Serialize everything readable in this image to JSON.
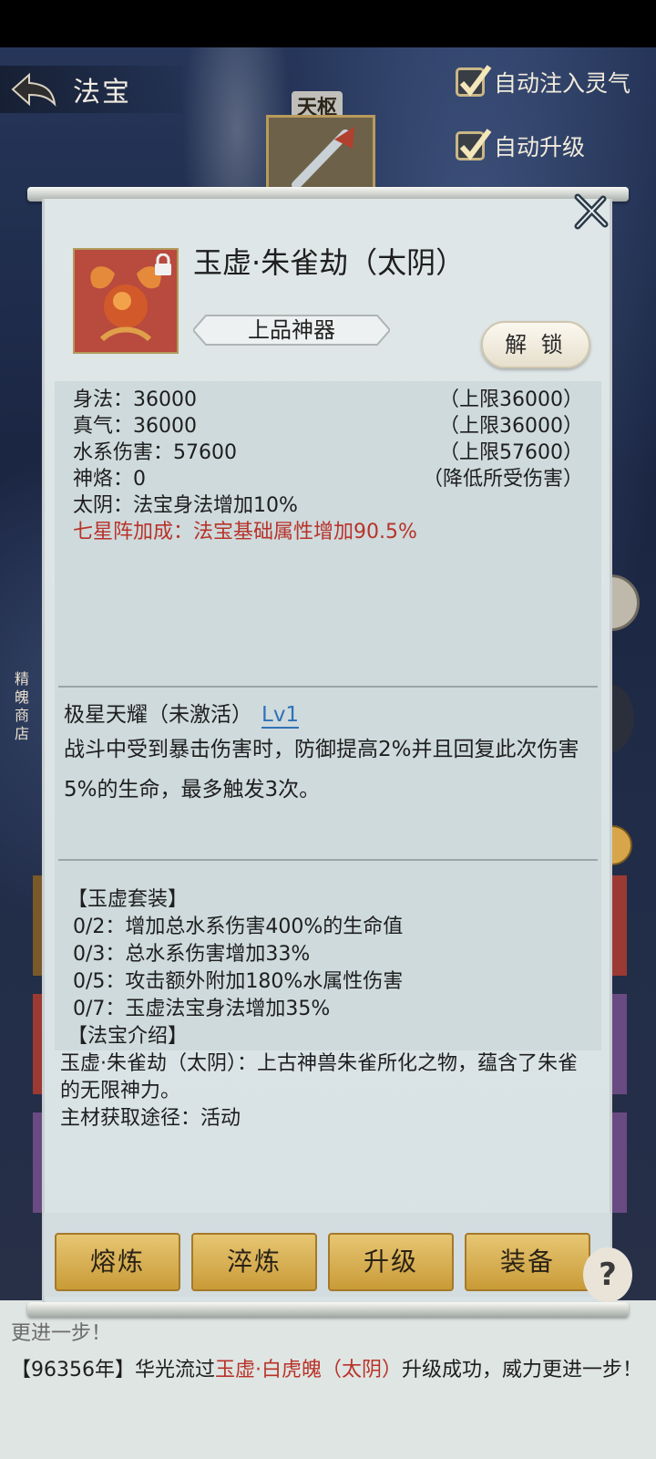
{
  "header": {
    "title": "法宝",
    "auto_options": [
      {
        "label": "自动注入灵气",
        "checked": true
      },
      {
        "label": "自动升级",
        "checked": true
      }
    ],
    "slot_label": "天枢"
  },
  "side": {
    "shop_label": "精魄商店"
  },
  "dialog": {
    "item_name": "玉虚·朱雀劫（太阴）",
    "grade": "上品神器",
    "unlock_label": "解 锁",
    "stats": [
      {
        "label": "身法：36000",
        "cap": "（上限36000）"
      },
      {
        "label": "真气：36000",
        "cap": "（上限36000）"
      },
      {
        "label": "水系伤害：57600",
        "cap": "（上限57600）"
      },
      {
        "label": "神烙：0",
        "cap": "（降低所受伤害）"
      },
      {
        "label": "太阴：法宝身法增加10%",
        "cap": ""
      }
    ],
    "bonus": "七星阵加成：法宝基础属性增加90.5%",
    "skill": {
      "name": "极星天耀（未激活）",
      "level": "Lv1",
      "description": "战斗中受到暴击伤害时，防御提高2%并且回复此次伤害5%的生命，最多触发3次。"
    },
    "set": {
      "title": "【玉虚套装】",
      "items": [
        "0/2：增加总水系伤害400%的生命值",
        "0/3：总水系伤害增加33%",
        "0/5：攻击额外附加180%水属性伤害",
        "0/7：玉虚法宝身法增加35%"
      ]
    },
    "intro": {
      "title": "【法宝介绍】",
      "text": "玉虚·朱雀劫（太阴）：上古神兽朱雀所化之物，蕴含了朱雀的无限神力。",
      "source": "主材获取途径：活动"
    },
    "actions": [
      "熔炼",
      "淬炼",
      "升级",
      "装备"
    ]
  },
  "log": {
    "cut_line_end": "更进一步！",
    "entry": {
      "prefix": "【96356年】华光流过",
      "item": "玉虚·白虎魄（太阴）",
      "suffix": "升级成功，威力更进一步！"
    }
  },
  "help_label": "?",
  "colors": {
    "highlight_red": "#b8322a",
    "gold_button": "#d8b055",
    "level_blue": "#2f72b7"
  }
}
